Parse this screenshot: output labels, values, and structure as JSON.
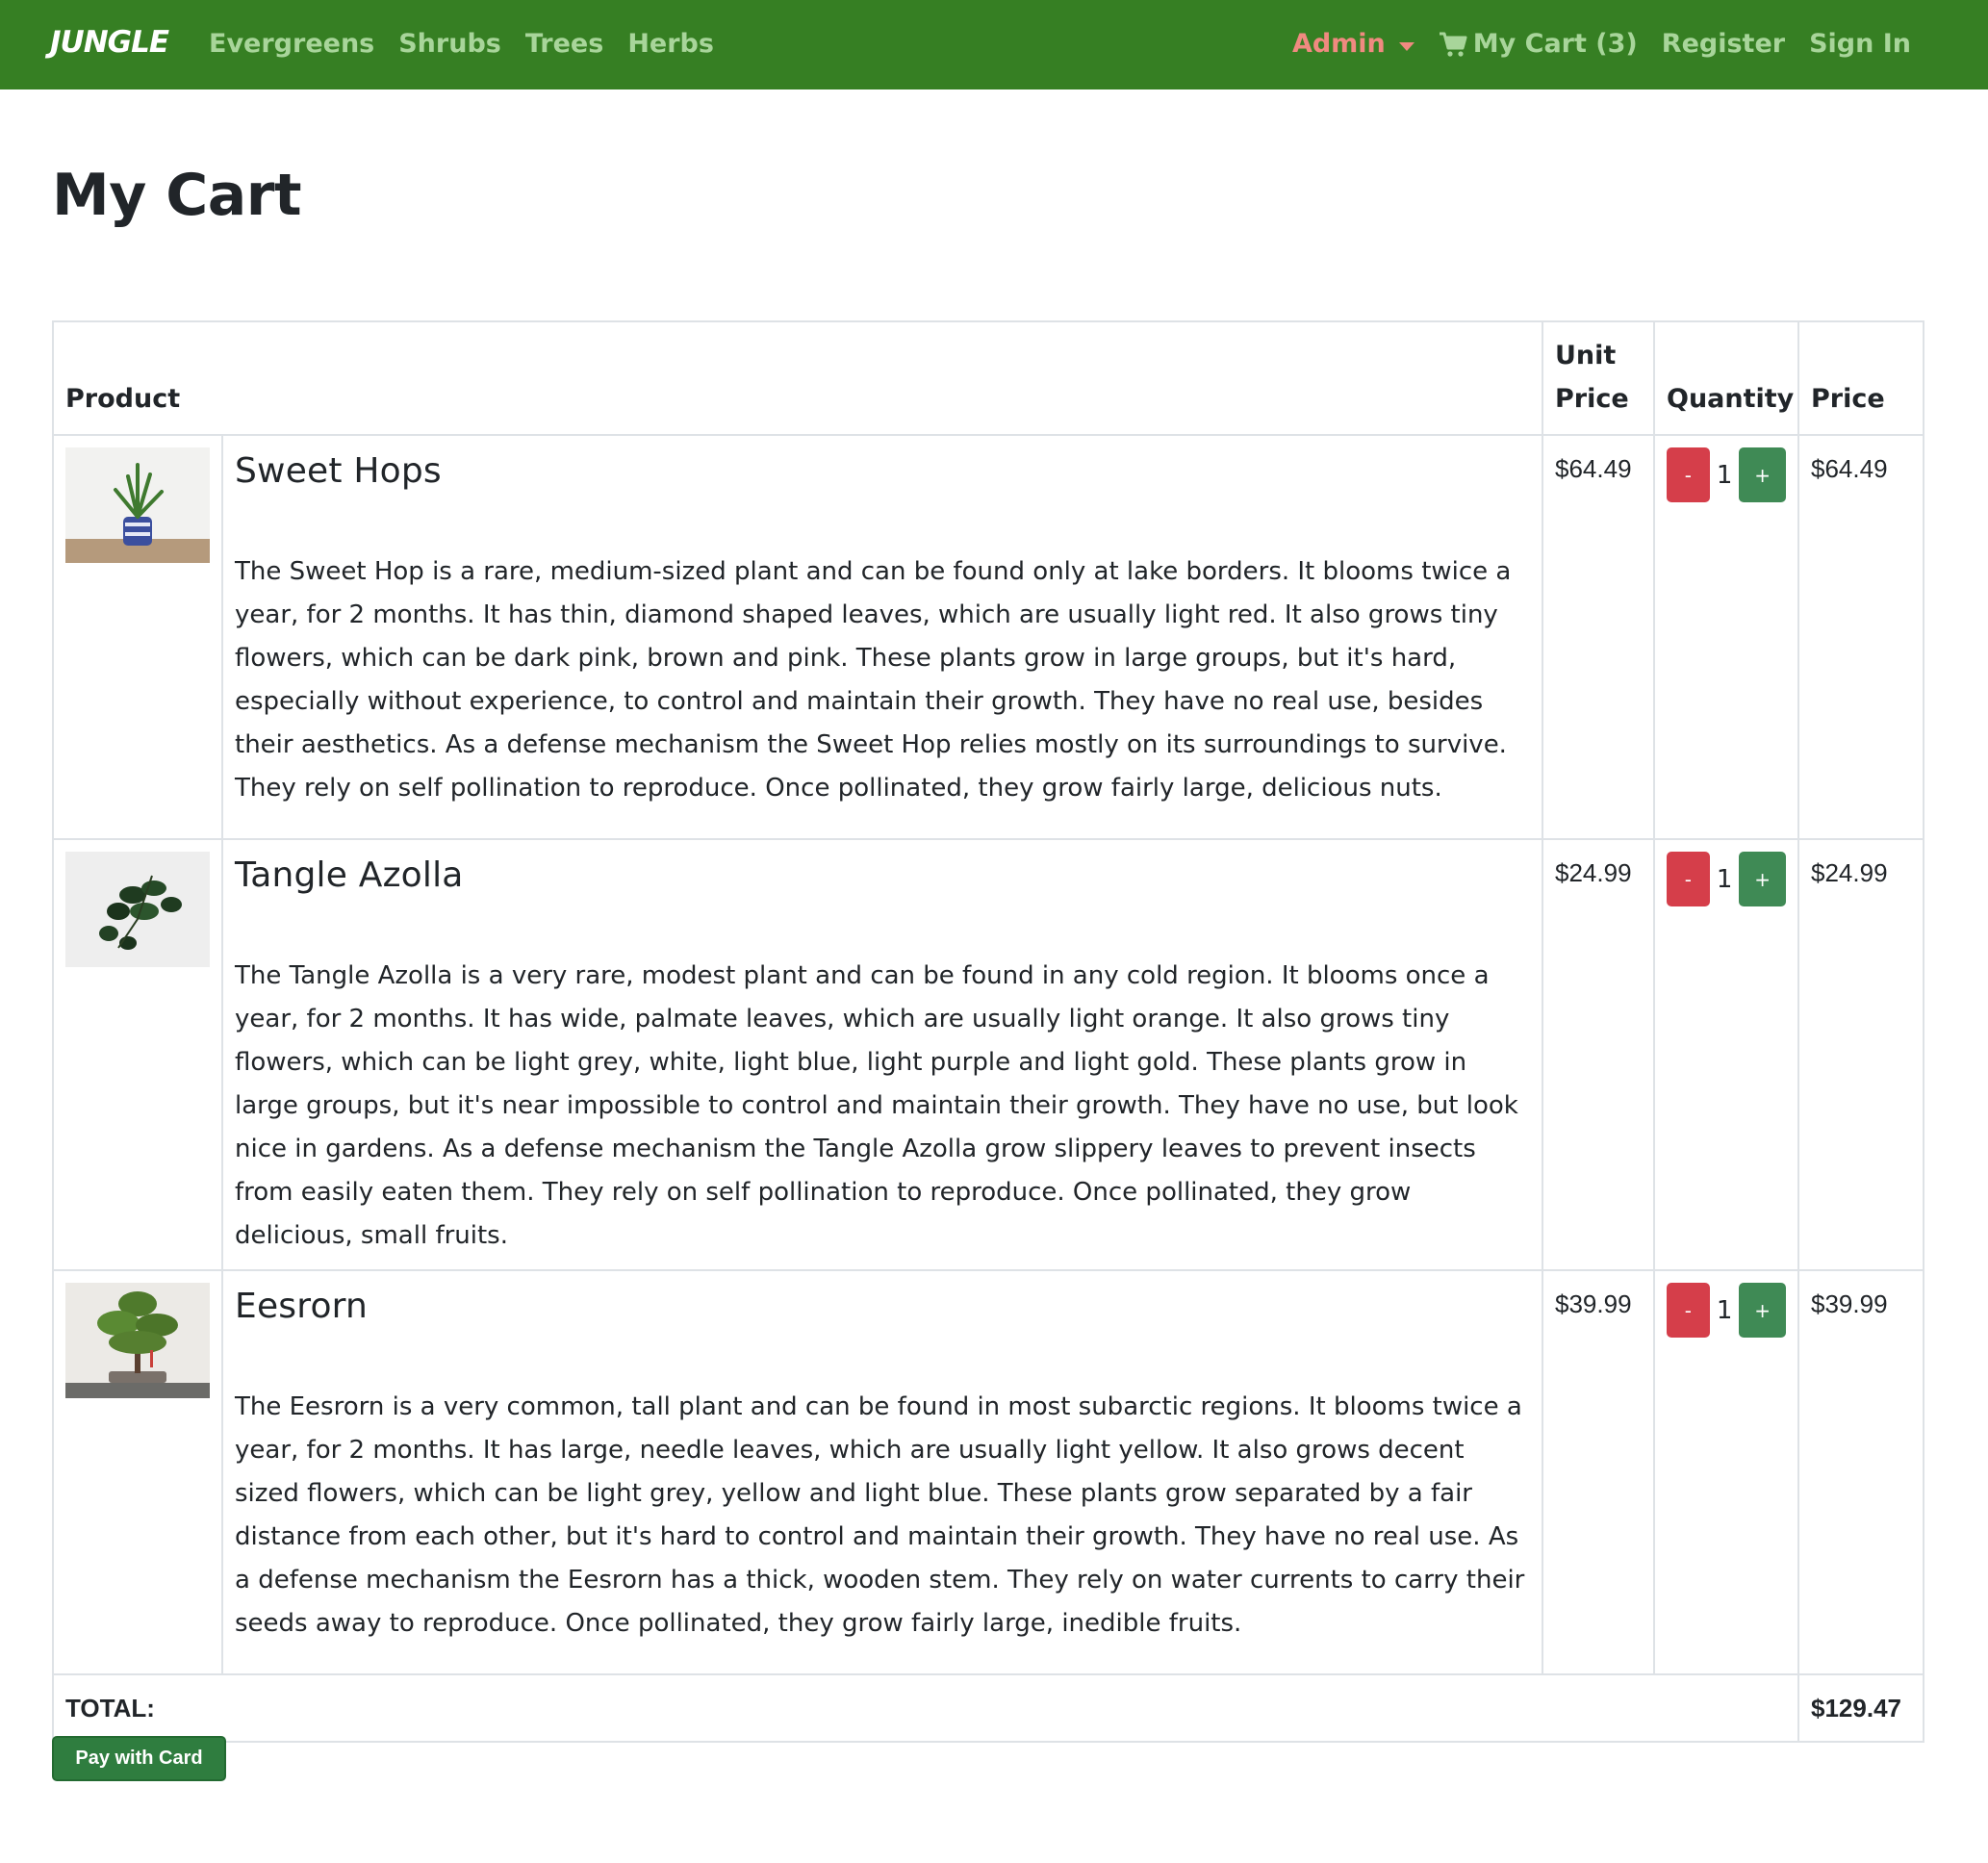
{
  "nav": {
    "brand": "JUNGLE",
    "left_links": [
      "Evergreens",
      "Shrubs",
      "Trees",
      "Herbs"
    ],
    "admin_label": "Admin",
    "cart_label": "My Cart (3)",
    "register_label": "Register",
    "signin_label": "Sign In"
  },
  "page_title": "My Cart",
  "table": {
    "headers": {
      "product": "Product",
      "unit_price": "Unit Price",
      "quantity": "Quantity",
      "price": "Price"
    },
    "items": [
      {
        "name": "Sweet Hops",
        "description": "The Sweet Hop is a rare, medium-sized plant and can be found only at lake borders. It blooms twice a year, for 2 months. It has thin, diamond shaped leaves, which are usually light red. It also grows tiny flowers, which can be dark pink, brown and pink. These plants grow in large groups, but it's hard, especially without experience, to control and maintain their growth. They have no real use, besides their aesthetics. As a defense mechanism the Sweet Hop relies mostly on its surroundings to survive. They rely on self pollination to reproduce. Once pollinated, they grow fairly large, delicious nuts.",
        "unit_price": "$64.49",
        "quantity": "1",
        "price": "$64.49",
        "minus_label": "-",
        "plus_label": "+"
      },
      {
        "name": "Tangle Azolla",
        "description": "The Tangle Azolla is a very rare, modest plant and can be found in any cold region. It blooms once a year, for 2 months. It has wide, palmate leaves, which are usually light orange. It also grows tiny flowers, which can be light grey, white, light blue, light purple and light gold. These plants grow in large groups, but it's near impossible to control and maintain their growth. They have no use, but look nice in gardens. As a defense mechanism the Tangle Azolla grow slippery leaves to prevent insects from easily eaten them. They rely on self pollination to reproduce. Once pollinated, they grow delicious, small fruits.",
        "unit_price": "$24.99",
        "quantity": "1",
        "price": "$24.99",
        "minus_label": "-",
        "plus_label": "+"
      },
      {
        "name": "Eesrorn",
        "description": "The Eesrorn is a very common, tall plant and can be found in most subarctic regions. It blooms twice a year, for 2 months. It has large, needle leaves, which are usually light yellow. It also grows decent sized flowers, which can be light grey, yellow and light blue. These plants grow separated by a fair distance from each other, but it's hard to control and maintain their growth. They have no real use. As a defense mechanism the Eesrorn has a thick, wooden stem. They rely on water currents to carry their seeds away to reproduce. Once pollinated, they grow fairly large, inedible fruits.",
        "unit_price": "$39.99",
        "quantity": "1",
        "price": "$39.99",
        "minus_label": "-",
        "plus_label": "+"
      }
    ],
    "total_label": "TOTAL:",
    "total_value": "$129.47"
  },
  "pay_button": "Pay with Card",
  "colors": {
    "navbar": "#367f23",
    "nav_link": "#a8d59a",
    "admin_link": "#f08a80",
    "minus_button": "#d53e4a",
    "plus_button": "#3f8a55",
    "pay_button": "#2f7d3f"
  },
  "icons": [
    "shopping-cart-icon",
    "caret-down-icon"
  ]
}
